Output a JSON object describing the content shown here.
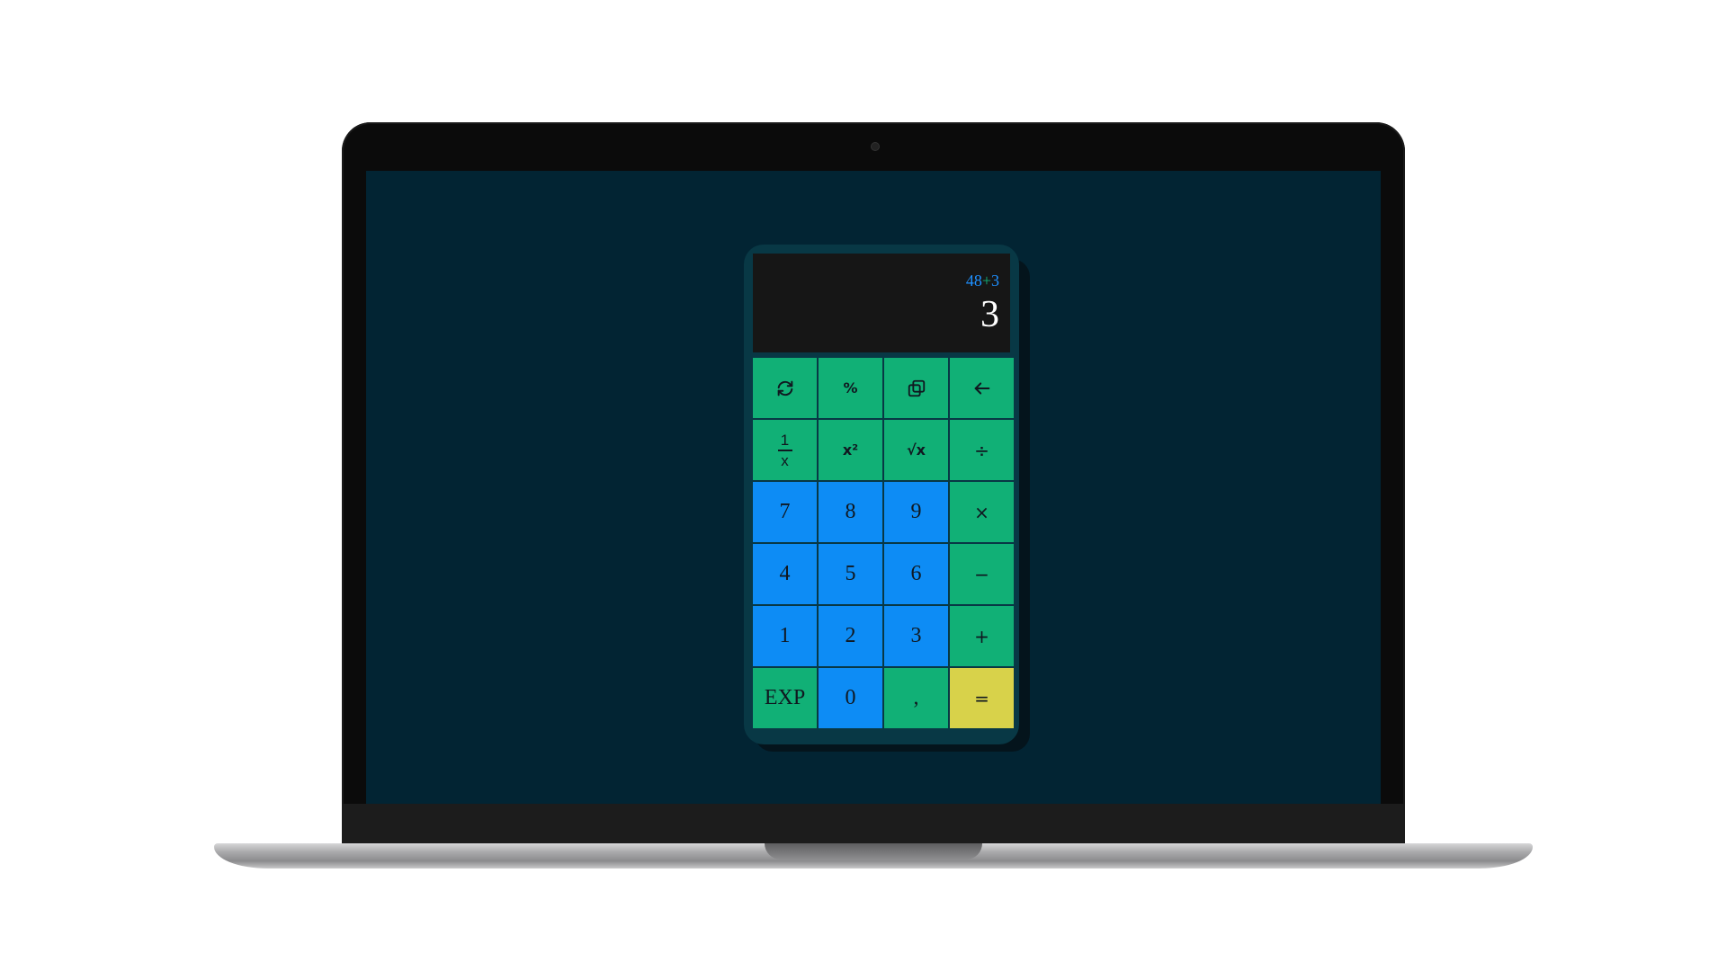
{
  "display": {
    "expression_left": "48",
    "expression_op": "+",
    "expression_right": "3",
    "result": "3"
  },
  "keys": {
    "refresh_icon": "refresh-icon",
    "percent": "%",
    "copy_icon": "copy-icon",
    "backspace_icon": "backspace-arrow-icon",
    "reciprocal_top": "1",
    "reciprocal_bottom": "x",
    "square": "x²",
    "sqrt": "√x",
    "divide": "÷",
    "seven": "7",
    "eight": "8",
    "nine": "9",
    "multiply": "×",
    "four": "4",
    "five": "5",
    "six": "6",
    "minus": "−",
    "one": "1",
    "two": "2",
    "three": "3",
    "plus": "+",
    "exp": "EXP",
    "zero": "0",
    "comma": ",",
    "equals": "="
  },
  "colors": {
    "screen_bg": "#022433",
    "calc_body": "#083845",
    "display_bg": "#161616",
    "function_key": "#11b076",
    "number_key": "#0d8cf5",
    "equals_key": "#d8d24a",
    "expression_text": "#1e90ff"
  }
}
